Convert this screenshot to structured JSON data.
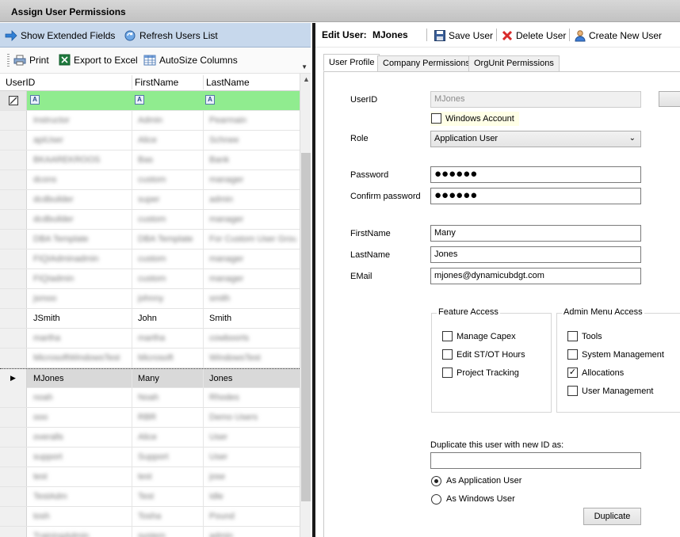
{
  "window": {
    "title": "Assign User Permissions"
  },
  "left_toolbar": {
    "show_extended": "Show Extended Fields",
    "refresh": "Refresh Users List",
    "print": "Print",
    "export": "Export to Excel",
    "autosize": "AutoSize Columns"
  },
  "grid": {
    "columns": [
      "UserID",
      "FirstName",
      "LastName"
    ],
    "rows": [
      {
        "userid": "Instructor",
        "first": "Admin",
        "last": "Pearmain",
        "blurred": true
      },
      {
        "userid": "apiUser",
        "first": "Alice",
        "last": "Schnee",
        "blurred": true
      },
      {
        "userid": "BKAAREKROOS",
        "first": "Bas",
        "last": "Bank",
        "blurred": true
      },
      {
        "userid": "dcons",
        "first": "custom",
        "last": "manager",
        "blurred": true
      },
      {
        "userid": "dcdbuilder",
        "first": "super",
        "last": "admin",
        "blurred": true
      },
      {
        "userid": "dcdbuilder",
        "first": "custom",
        "last": "manager",
        "blurred": true
      },
      {
        "userid": "DBA Template",
        "first": "DBA Template",
        "last": "For Custom User Groups",
        "blurred": true
      },
      {
        "userid": "FIQIAdminadmin",
        "first": "custom",
        "last": "manager",
        "blurred": true
      },
      {
        "userid": "FIQIadmin",
        "first": "custom",
        "last": "manager",
        "blurred": true
      },
      {
        "userid": "jsmoo",
        "first": "johnny",
        "last": "smith",
        "blurred": true
      },
      {
        "userid": "JSmith",
        "first": "John",
        "last": "Smith",
        "blurred": false
      },
      {
        "userid": "martha",
        "first": "martha",
        "last": "cowboorts",
        "blurred": true
      },
      {
        "userid": "MicrosoftWindowsTest",
        "first": "Microsoft",
        "last": "WindowsTest",
        "blurred": true
      },
      {
        "userid": "MJones",
        "first": "Many",
        "last": "Jones",
        "blurred": false,
        "current": true
      },
      {
        "userid": "noah",
        "first": "Noah",
        "last": "Rhodes",
        "blurred": true
      },
      {
        "userid": "ooo",
        "first": "RBR",
        "last": "Demo Users",
        "blurred": true
      },
      {
        "userid": "overalls",
        "first": "Alice",
        "last": "User",
        "blurred": true
      },
      {
        "userid": "support",
        "first": "Support",
        "last": "User",
        "blurred": true
      },
      {
        "userid": "test",
        "first": "test",
        "last": "jose",
        "blurred": true
      },
      {
        "userid": "TestAdm",
        "first": "Test",
        "last": "Idle",
        "blurred": true
      },
      {
        "userid": "tosh",
        "first": "Tosha",
        "last": "Pound",
        "blurred": true
      },
      {
        "userid": "TrainingAdmin",
        "first": "system",
        "last": "admin",
        "blurred": true
      }
    ]
  },
  "edit_panel": {
    "edit_user_label": "Edit User:",
    "edit_user_value": "MJones",
    "save": "Save User",
    "delete": "Delete User",
    "create": "Create New User",
    "tabs": [
      "User Profile",
      "Company Permissions",
      "OrgUnit Permissions"
    ],
    "userid_label": "UserID",
    "userid_value": "MJones",
    "windows_account": "Windows Account",
    "role_label": "Role",
    "role_value": "Application User",
    "password_label": "Password",
    "password_value": "●●●●●●",
    "confirm_label": "Confirm password",
    "confirm_value": "●●●●●●",
    "firstname_label": "FirstName",
    "firstname_value": "Many",
    "lastname_label": "LastName",
    "lastname_value": "Jones",
    "email_label": "EMail",
    "email_value": "mjones@dynamicubdgt.com",
    "feature_access": {
      "title": "Feature Access",
      "items": [
        {
          "label": "Manage Capex",
          "checked": false
        },
        {
          "label": "Edit ST/OT Hours",
          "checked": false
        },
        {
          "label": "Project Tracking",
          "checked": false
        }
      ]
    },
    "admin_menu": {
      "title": "Admin Menu Access",
      "items": [
        {
          "label": "Tools",
          "checked": false
        },
        {
          "label": "System Management",
          "checked": false
        },
        {
          "label": "Allocations",
          "checked": true
        },
        {
          "label": "User Management",
          "checked": false
        }
      ]
    },
    "duplicate_label": "Duplicate this user with new ID as:",
    "duplicate_value": "",
    "radio_app": "As Application User",
    "radio_win": "As Windows User",
    "duplicate_button": "Duplicate"
  }
}
